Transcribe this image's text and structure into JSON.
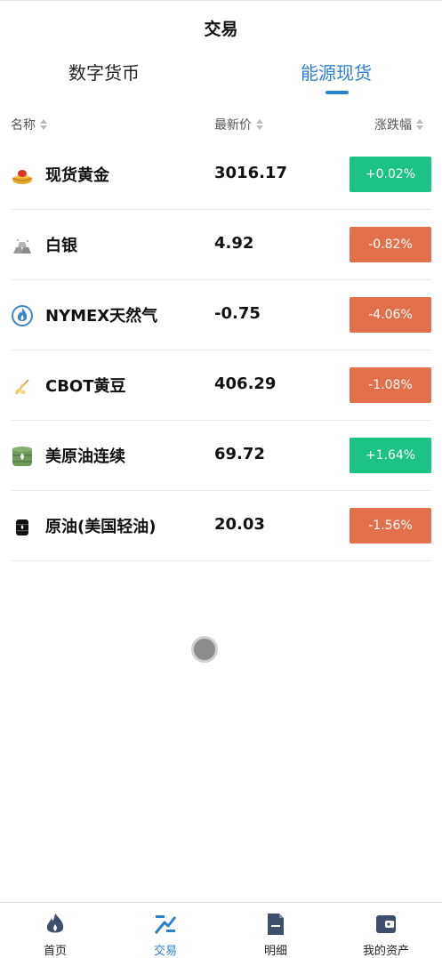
{
  "header": {
    "title": "交易"
  },
  "tabs": [
    {
      "label": "数字货币",
      "active": false
    },
    {
      "label": "能源现货",
      "active": true
    }
  ],
  "columns": {
    "name": "名称",
    "price": "最新价",
    "change": "涨跌幅"
  },
  "rows": [
    {
      "icon": "gold-ingot-icon",
      "name": "现货黄金",
      "price": "3016.17",
      "change": "+0.02%",
      "direction": "up"
    },
    {
      "icon": "silver-bars-icon",
      "name": "白银",
      "price": "4.92",
      "change": "-0.82%",
      "direction": "down"
    },
    {
      "icon": "gas-flame-icon",
      "name": "NYMEX天然气",
      "price": "-0.75",
      "change": "-4.06%",
      "direction": "down"
    },
    {
      "icon": "soybean-icon",
      "name": "CBOT黄豆",
      "price": "406.29",
      "change": "-1.08%",
      "direction": "down"
    },
    {
      "icon": "oil-barrel-green-icon",
      "name": "美原油连续",
      "price": "69.72",
      "change": "+1.64%",
      "direction": "up"
    },
    {
      "icon": "oil-barrel-black-icon",
      "name": "原油(美国轻油)",
      "price": "20.03",
      "change": "-1.56%",
      "direction": "down"
    }
  ],
  "bottom_nav": [
    {
      "label": "首页",
      "icon": "flame-icon",
      "active": false
    },
    {
      "label": "交易",
      "icon": "trade-icon",
      "active": true
    },
    {
      "label": "明细",
      "icon": "document-icon",
      "active": false
    },
    {
      "label": "我的资产",
      "icon": "wallet-icon",
      "active": false
    }
  ],
  "colors": {
    "accent": "#2d7fd1",
    "up": "#1cc385",
    "down": "#e2704a"
  }
}
